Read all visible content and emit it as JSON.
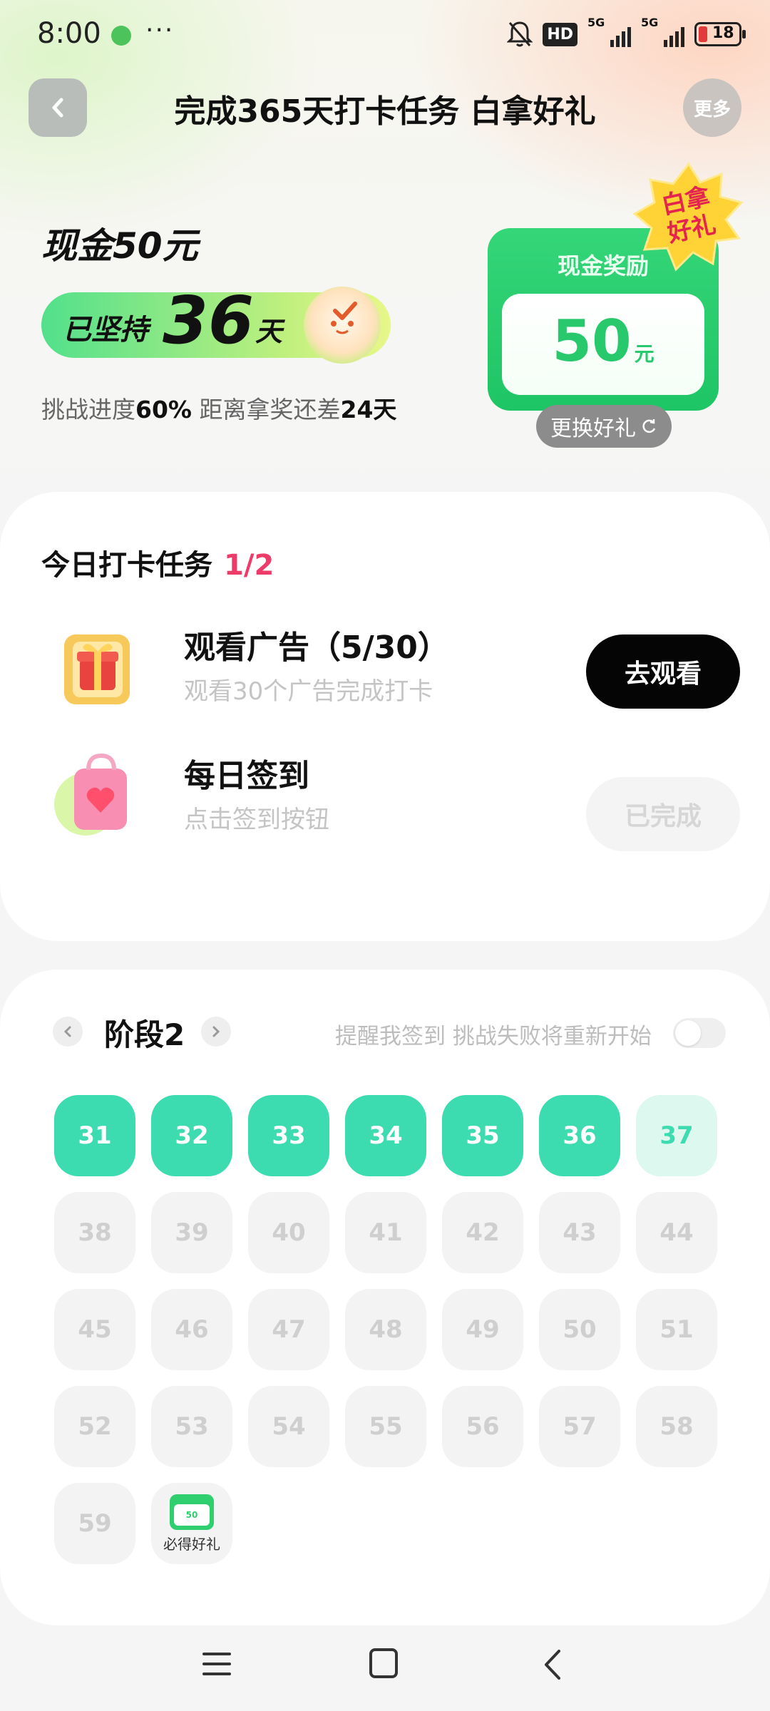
{
  "status_bar": {
    "time": "8:00",
    "more": "···",
    "hd_label": "HD",
    "signal1_label": "5G",
    "signal2_label": "5G",
    "battery": "18"
  },
  "header": {
    "title": "完成365天打卡任务 白拿好礼",
    "more_label": "更多"
  },
  "hero": {
    "prize_name": "现金50元",
    "streak_prefix": "已坚持",
    "streak_days": "36",
    "streak_unit": "天",
    "progress_prefix": "挑战进度",
    "progress_percent": "60%",
    "progress_middle": " 距离拿奖还差",
    "remaining_days": "24天"
  },
  "reward_card": {
    "title": "现金奖励",
    "amount": "50",
    "unit": "元",
    "badge_line1": "白拿",
    "badge_line2": "好礼",
    "swap_label": "更换好礼"
  },
  "tasks": {
    "heading": "今日打卡任务",
    "count": "1/2",
    "items": [
      {
        "name": "观看广告（5/30）",
        "desc": "观看30个广告完成打卡",
        "button": "去观看"
      },
      {
        "name": "每日签到",
        "desc": "点击签到按钮",
        "button": "已完成"
      }
    ]
  },
  "stage": {
    "label": "阶段2",
    "remind_text": "提醒我签到 挑战失败将重新开始",
    "days": [
      {
        "label": "31",
        "state": "done"
      },
      {
        "label": "32",
        "state": "done"
      },
      {
        "label": "33",
        "state": "done"
      },
      {
        "label": "34",
        "state": "done"
      },
      {
        "label": "35",
        "state": "done"
      },
      {
        "label": "36",
        "state": "done"
      },
      {
        "label": "37",
        "state": "next"
      },
      {
        "label": "38",
        "state": "future"
      },
      {
        "label": "39",
        "state": "future"
      },
      {
        "label": "40",
        "state": "future"
      },
      {
        "label": "41",
        "state": "future"
      },
      {
        "label": "42",
        "state": "future"
      },
      {
        "label": "43",
        "state": "future"
      },
      {
        "label": "44",
        "state": "future"
      },
      {
        "label": "45",
        "state": "future"
      },
      {
        "label": "46",
        "state": "future"
      },
      {
        "label": "47",
        "state": "future"
      },
      {
        "label": "48",
        "state": "future"
      },
      {
        "label": "49",
        "state": "future"
      },
      {
        "label": "50",
        "state": "future"
      },
      {
        "label": "51",
        "state": "future"
      },
      {
        "label": "52",
        "state": "future"
      },
      {
        "label": "53",
        "state": "future"
      },
      {
        "label": "54",
        "state": "future"
      },
      {
        "label": "55",
        "state": "future"
      },
      {
        "label": "56",
        "state": "future"
      },
      {
        "label": "57",
        "state": "future"
      },
      {
        "label": "58",
        "state": "future"
      },
      {
        "label": "59",
        "state": "future"
      }
    ],
    "prize_cell": {
      "ticket_value": "50",
      "label": "必得好礼"
    }
  },
  "colors": {
    "accent_green": "#3ddbb0",
    "reward_green": "#1ec565",
    "count_pink": "#ee3c6a"
  }
}
